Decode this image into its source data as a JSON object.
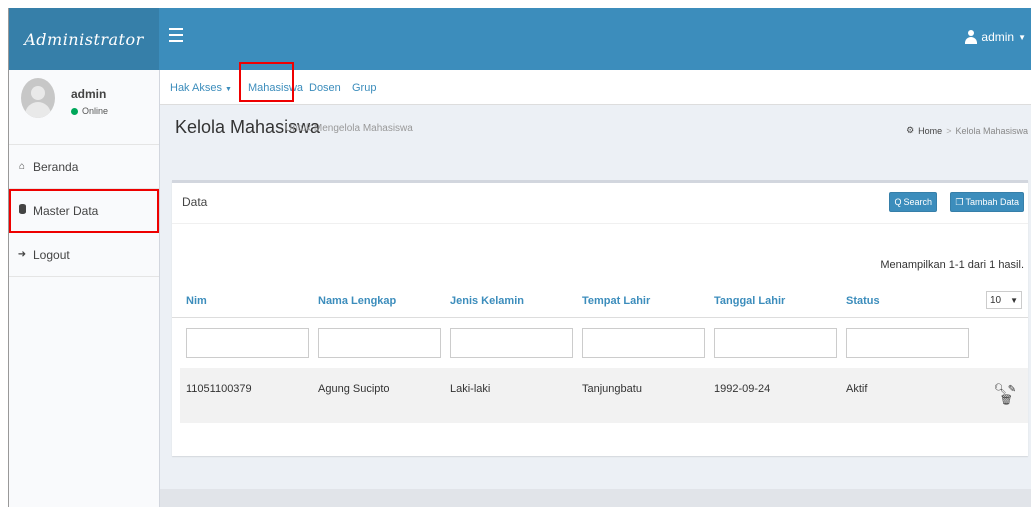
{
  "brand": "Administrator",
  "header": {
    "user": "admin"
  },
  "sidebar": {
    "user_name": "admin",
    "user_status": "Online",
    "items": [
      {
        "label": "Beranda",
        "icon": "home-icon"
      },
      {
        "label": "Master Data",
        "icon": "database-icon"
      },
      {
        "label": "Logout",
        "icon": "logout-icon"
      }
    ]
  },
  "tabs": [
    "Hak Akses",
    "Mahasiswa",
    "Dosen",
    "Grup"
  ],
  "page": {
    "title": "Kelola Mahasiswa",
    "subtitle": "Untuk Mengelola Mahasiswa",
    "breadcrumb": [
      "Home",
      "Kelola Mahasiswa"
    ]
  },
  "box": {
    "title": "Data",
    "search_label": "Search",
    "add_label": "Tambah Data",
    "summary": "Menampilkan 1-1 dari 1 hasil.",
    "page_size": "10",
    "columns": [
      "Nim",
      "Nama Lengkap",
      "Jenis Kelamin",
      "Tempat Lahir",
      "Tanggal Lahir",
      "Status"
    ],
    "rows": [
      [
        "11051100379",
        "Agung Sucipto",
        "Laki-laki",
        "Tanjungbatu",
        "1992-09-24",
        "Aktif"
      ]
    ]
  },
  "colors": {
    "header": "#3c8dbc",
    "logo": "#367fa9",
    "highlight": "#e00000",
    "online": "#00a65a"
  }
}
